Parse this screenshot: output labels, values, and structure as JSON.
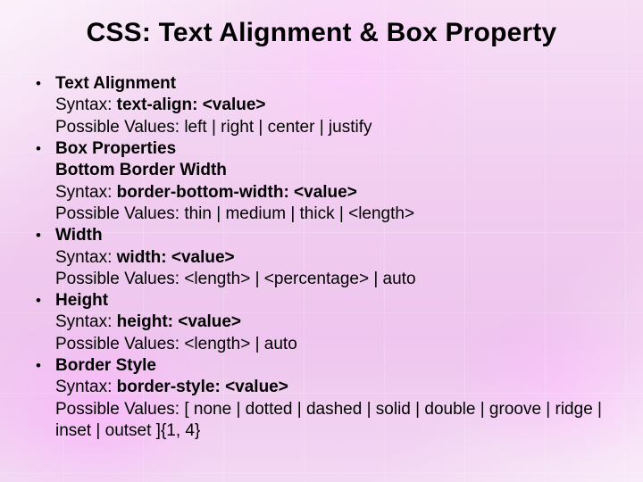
{
  "title": "CSS: Text Alignment & Box Property",
  "bullet": "•",
  "items": [
    {
      "heading": "Text Alignment",
      "syntax_label": "Syntax: ",
      "syntax_code": "text-align: <value>",
      "values": "Possible Values: left | right | center | justify"
    },
    {
      "heading": "Box Properties",
      "sub_heading": "Bottom Border Width",
      "syntax_label": "Syntax: ",
      "syntax_code": "border-bottom-width: <value>",
      "values": "Possible Values: thin | medium | thick | <length>"
    },
    {
      "heading": "Width",
      "syntax_label": "Syntax: ",
      "syntax_code": "width: <value>",
      "values": "Possible Values: <length> | <percentage> | auto"
    },
    {
      "heading": "Height",
      "syntax_label": "Syntax: ",
      "syntax_code": "height: <value>",
      "values": "Possible Values: <length> | auto"
    },
    {
      "heading": "Border Style",
      "syntax_label": "Syntax: ",
      "syntax_code": "border-style: <value>",
      "values": "Possible Values: [ none | dotted | dashed | solid | double | groove | ridge | inset | outset ]{1, 4}"
    }
  ]
}
